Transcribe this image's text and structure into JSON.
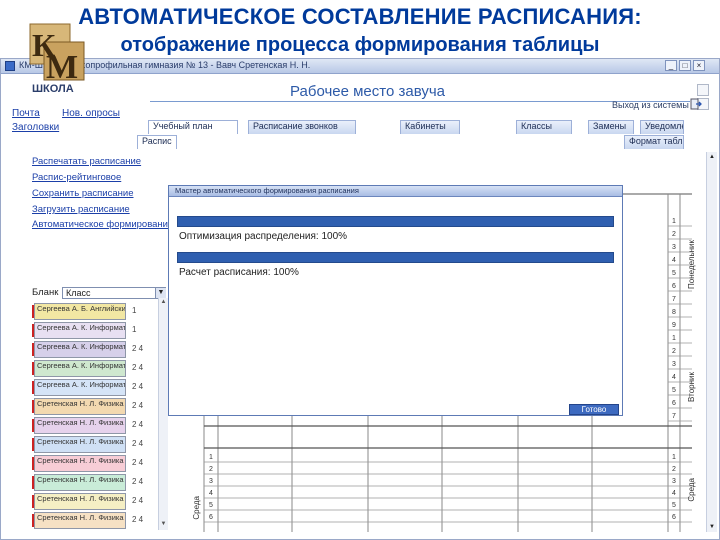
{
  "slide": {
    "title": "АВТОМАТИЧЕСКОЕ СОСТАВЛЕНИЕ РАСПИСАНИЯ:",
    "subtitle": "отображение процесса формирования таблицы"
  },
  "window": {
    "title": "КМ-Школа - мокопрофильная гимназия № 13 - Вавч Сретенская Н. Н.",
    "buttons": [
      "_",
      "□",
      "×"
    ]
  },
  "header": {
    "logo_top": "КМ",
    "logo_bottom": "ШКОЛА",
    "title": "Рабочее место завуча",
    "exit_label": "Выход из системы"
  },
  "nav": {
    "links": [
      "Почта",
      "Нов. опросы",
      "Заголовки"
    ]
  },
  "tabs": [
    "Учебный план",
    "Расписание звонков",
    "Кабинеты",
    "Классы",
    "Замены",
    "Уведомление"
  ],
  "tab_sub": {
    "main_left": "Распис",
    "right": "Формат таблиц"
  },
  "left_panel": {
    "links": [
      "Распечатать расписание",
      "Распис-рейтинговое",
      "Сохранить расписание",
      "Загрузить расписание",
      "Автоматическое формирование"
    ],
    "week_label": "Бланк",
    "week_value": "Класс"
  },
  "cards": [
    {
      "text": "Сергеева А. Б. Английский",
      "num": "1",
      "color": "#f2e7a3"
    },
    {
      "text": "Сергеева А. К. Информатика",
      "num": "1",
      "color": "#e8e0f2"
    },
    {
      "text": "Сергеева А. К. Информатика",
      "num": "2 4",
      "color": "#d6d0ea"
    },
    {
      "text": "Сергеева А. К. Информатика",
      "num": "2 4",
      "color": "#cfe8cf"
    },
    {
      "text": "Сергеева А. К. Информатика",
      "num": "2 4",
      "color": "#d5e4f7"
    },
    {
      "text": "Сретенская Н. Л. Физика",
      "num": "2 4",
      "color": "#f3d9b0"
    },
    {
      "text": "Сретенская Н. Л. Физика",
      "num": "2 4",
      "color": "#e6d2ec"
    },
    {
      "text": "Сретенская Н. Л. Физика",
      "num": "2 4",
      "color": "#cfe0f5"
    },
    {
      "text": "Сретенская Н. Л. Физика",
      "num": "2 4",
      "color": "#f7cdd6"
    },
    {
      "text": "Сретенская Н. Л. Физика",
      "num": "2 4",
      "color": "#c9ecd8"
    },
    {
      "text": "Сретенская Н. Л. Физика",
      "num": "2 4",
      "color": "#f5efc4"
    },
    {
      "text": "Сретенская Н. Л. Физика",
      "num": "2 4",
      "color": "#f6e1c4"
    }
  ],
  "grid": {
    "row_numbers_top": [
      "1",
      "2",
      "3",
      "4",
      "5",
      "6",
      "7",
      "8",
      "9",
      "1",
      "2",
      "3",
      "4",
      "5",
      "6",
      "7"
    ],
    "row_numbers_bottom": [
      "1",
      "2",
      "3",
      "4",
      "5",
      "6"
    ],
    "right_day_labels": [
      "Понедельник",
      "Вторник",
      "Среда"
    ],
    "left_day_label": "Среда"
  },
  "dialog": {
    "title": "Мастер автоматического формирования расписания",
    "line1": "Оптимизация распределения: 100%",
    "line2": "Расчет расписания: 100%",
    "button": "Готово",
    "progress1": 1.0,
    "progress2": 1.0
  },
  "colors": {
    "title_blue": "#003a9b",
    "progress_blue": "#2f5fb0",
    "link_blue": "#1b3fa8"
  }
}
